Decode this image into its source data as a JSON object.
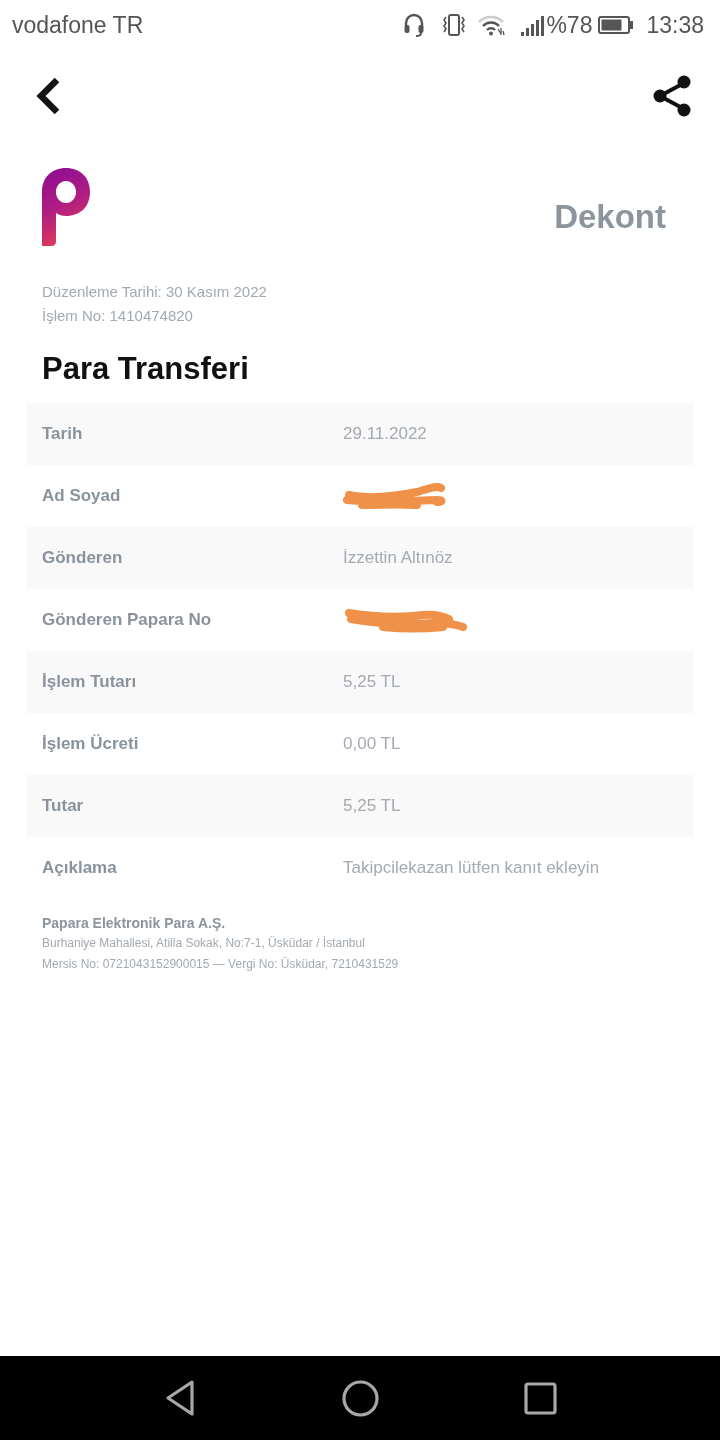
{
  "status_bar": {
    "carrier": "vodafone TR",
    "battery_percent": "%78",
    "time": "13:38"
  },
  "header": {
    "title": "Dekont"
  },
  "receipt": {
    "issue_date": "Düzenleme Tarihi: 30 Kasım 2022",
    "transaction_no": "İşlem No: 1410474820",
    "title": "Para Transferi",
    "rows": [
      {
        "label": "Tarih",
        "value": "29.11.2022",
        "redacted": false
      },
      {
        "label": "Ad Soyad",
        "redacted": true
      },
      {
        "label": "Gönderen",
        "value": "İzzettin Altınöz",
        "redacted": false
      },
      {
        "label": "Gönderen Papara No",
        "redacted": true
      },
      {
        "label": "İşlem Tutarı",
        "value": "5,25 TL",
        "redacted": false
      },
      {
        "label": "İşlem Ücreti",
        "value": "0,00 TL",
        "redacted": false
      },
      {
        "label": "Tutar",
        "value": "5,25 TL",
        "redacted": false
      },
      {
        "label": "Açıklama",
        "value": "Takipcilekazan lütfen kanıt ekleyin",
        "redacted": false
      }
    ]
  },
  "footer": {
    "company": "Papara Elektronik Para A.Ş.",
    "address": "Burhaniye Mahallesi, Atilla Sokak, No:7-1, Üsküdar / İstanbul",
    "registry": "Mersis No: 0721043152900015 — Vergi No: Üsküdar, 7210431529"
  }
}
